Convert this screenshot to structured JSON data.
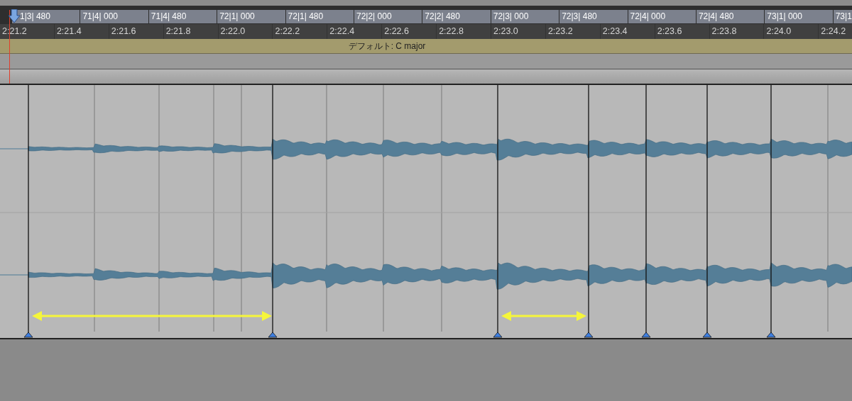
{
  "bar_ruler": {
    "labels": [
      "1|3| 480",
      "71|4| 000",
      "71|4| 480",
      "72|1| 000",
      "72|1| 480",
      "72|2| 000",
      "72|2| 480",
      "72|3| 000",
      "72|3| 480",
      "72|4| 000",
      "72|4| 480",
      "73|1| 000",
      "73|1"
    ]
  },
  "time_ruler": {
    "labels": [
      "2:21.2",
      "2:21.4",
      "2:21.6",
      "2:21.8",
      "2:22.0",
      "2:22.2",
      "2:22.4",
      "2:22.6",
      "2:22.8",
      "2:23.0",
      "2:23.2",
      "2:23.4",
      "2:23.6",
      "2:23.8",
      "2:24.0",
      "2:24.2"
    ]
  },
  "chord_track": {
    "label": "デフォルト: C major"
  }
}
